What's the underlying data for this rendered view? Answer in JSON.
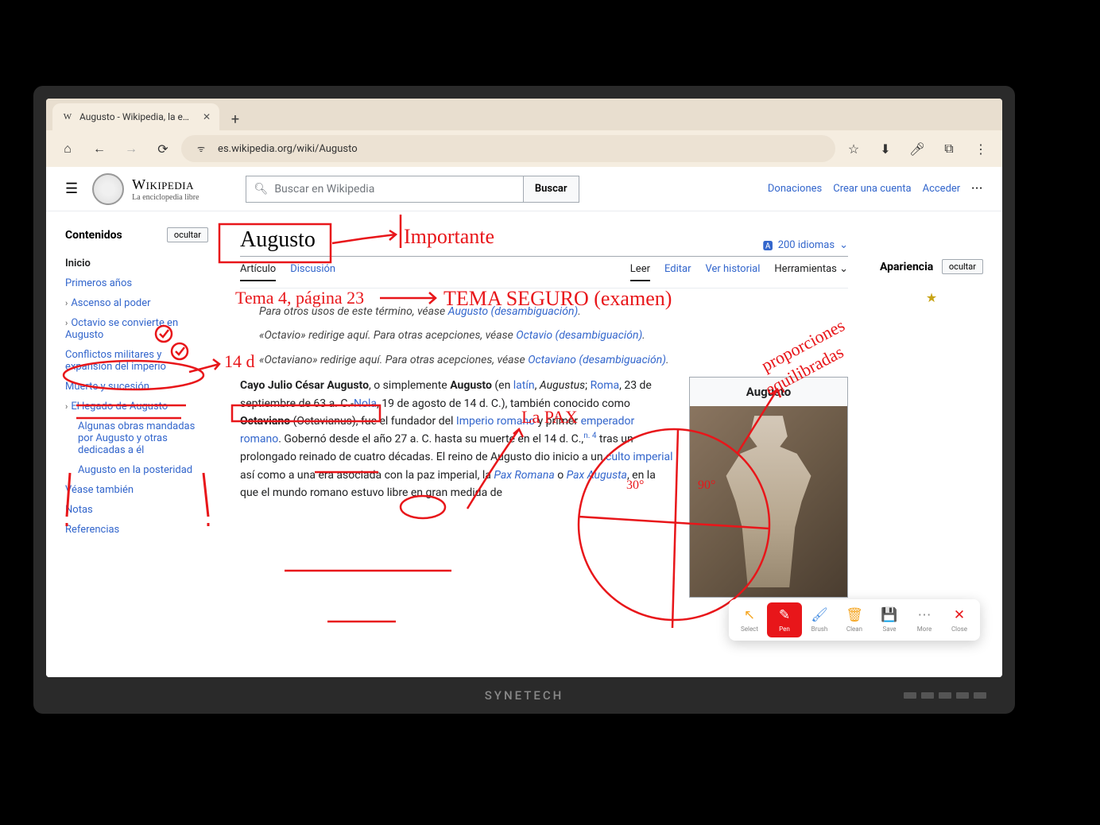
{
  "monitor": {
    "brand": "SYNETECH"
  },
  "browser": {
    "tab_title": "Augusto - Wikipedia, la enciclop",
    "url": "es.wikipedia.org/wiki/Augusto"
  },
  "wiki": {
    "wordmark_top": "Wikipedia",
    "wordmark_sub": "La enciclopedia libre",
    "search_placeholder": "Buscar en Wikipedia",
    "search_button": "Buscar",
    "user_links": {
      "donate": "Donaciones",
      "create": "Crear una cuenta",
      "login": "Acceder"
    },
    "toc_title": "Contenidos",
    "hide_label": "ocultar",
    "appearance_title": "Apariencia",
    "toc": {
      "inicio": "Inicio",
      "primeros": "Primeros años",
      "ascenso": "Ascenso al poder",
      "octavio": "Octavio se convierte en Augusto",
      "conflictos": "Conflictos militares y expansión del imperio",
      "muerte": "Muerte y sucesión",
      "legado": "El legado de Augusto",
      "obras": "Algunas obras mandadas por Augusto y otras dedicadas a él",
      "posteridad": "Augusto en la posteridad",
      "vease": "Véase también",
      "notas": "Notas",
      "refs": "Referencias"
    },
    "article": {
      "title": "Augusto",
      "lang_count": "200 idiomas",
      "tabs": {
        "articulo": "Artículo",
        "discusion": "Discusión",
        "leer": "Leer",
        "editar": "Editar",
        "historial": "Ver historial",
        "herramientas": "Herramientas"
      },
      "hatnote1_pre": "Para otros usos de este término, véase ",
      "hatnote1_link": "Augusto (desambiguación)",
      "hatnote2_pre": "«Octavio» redirige aquí. Para otras acepciones, véase ",
      "hatnote2_link": "Octavio (desambiguación)",
      "hatnote3_pre": "«Octaviano» redirige aquí. Para otras acepciones, véase ",
      "hatnote3_link": "Octaviano (desambiguación)",
      "p_bold1": "Cayo Julio César Augusto",
      "p_seg1": ", o simplemente ",
      "p_bold2": "Augusto",
      "p_seg2": " (en ",
      "p_link_latin": "latín",
      "p_seg3": ", ",
      "p_ital1": "Augustus",
      "p_seg4": "; ",
      "p_link_roma": "Roma",
      "p_seg5": ", 23 de septiembre de 63 a. C.-",
      "p_link_nola": "Nola",
      "p_seg6": ", 19 de agosto de 14 d. C.), también conocido como ",
      "p_bold3": "Octaviano",
      "p_seg7": " (Octavianus), fue el fundador del ",
      "p_link_imp": "Imperio romano",
      "p_seg8": " y primer ",
      "p_link_emp": "emperador romano",
      "p_seg9": ". Gobernó desde el año 27 a. C. hasta su muerte en el 14 d. C.,",
      "p_sup": "n. 4",
      "p_seg10": " tras un prolongado reinado de cuatro décadas. El reino de Augusto dio inicio a un ",
      "p_link_culto": "culto imperial",
      "p_seg11": " así como a una era asociada con la paz imperial, la ",
      "p_link_pax1": "Pax Romana",
      "p_seg12": " o ",
      "p_link_pax2": "Pax Augusta",
      "p_seg13": ", en la que el mundo romano estuvo libre en gran medida de",
      "infobox_title": "Augusto"
    }
  },
  "annotations": {
    "importante": "Importante",
    "tema_pag": "Tema 4, página 23",
    "tema_seguro": "TEMA SEGURO (examen)",
    "catorce": "14 d",
    "la_pax": "La PAX",
    "proporciones": "proporciones",
    "equilibradas": "equilibradas",
    "ang30": "30°",
    "ang90": "90°"
  },
  "whiteboard": {
    "select": "Select",
    "pen": "Pen",
    "brush": "Brush",
    "clean": "Clean",
    "save": "Save",
    "more": "More",
    "close": "Close"
  }
}
